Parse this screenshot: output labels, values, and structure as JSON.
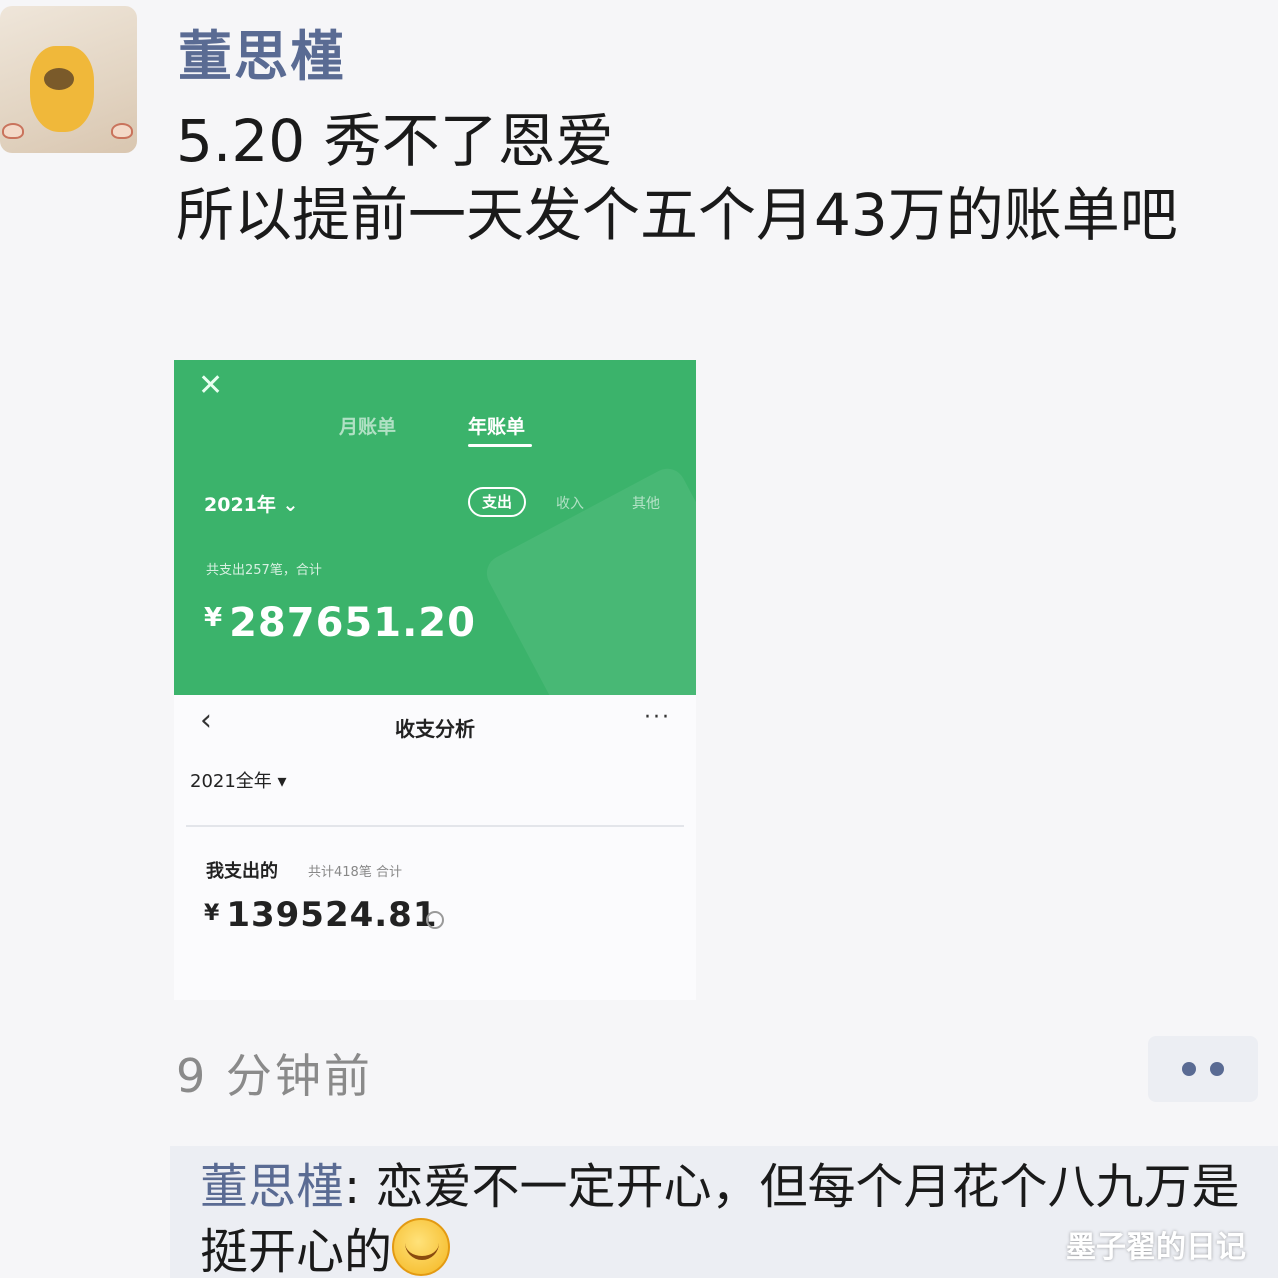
{
  "post": {
    "author": "董思槿",
    "line1": "5.20 秀不了恩爱",
    "line2": "所以提前一天发个五个月43万的账单吧",
    "time": "9 分钟前"
  },
  "bill_card": {
    "close_icon": "✕",
    "tab_month": "月账单",
    "tab_year": "年账单",
    "year": "2021年 ⌄",
    "chip": "支出",
    "opt_income": "收入",
    "opt_other": "其他",
    "summary": "共支出257笔，合计",
    "currency": "¥",
    "amount": "287651.20"
  },
  "analysis": {
    "back_icon": "‹",
    "title": "收支分析",
    "more_icon": "···",
    "year": "2021全年 ▾",
    "label": "我支出的",
    "meta": "共计418笔 合计",
    "currency": "¥",
    "amount": "139524.81"
  },
  "comment": {
    "author": "董思槿",
    "text": ": 恋爱不一定开心，但每个月花个八九万是挺开心的"
  },
  "watermark": "墨子翟的日记"
}
